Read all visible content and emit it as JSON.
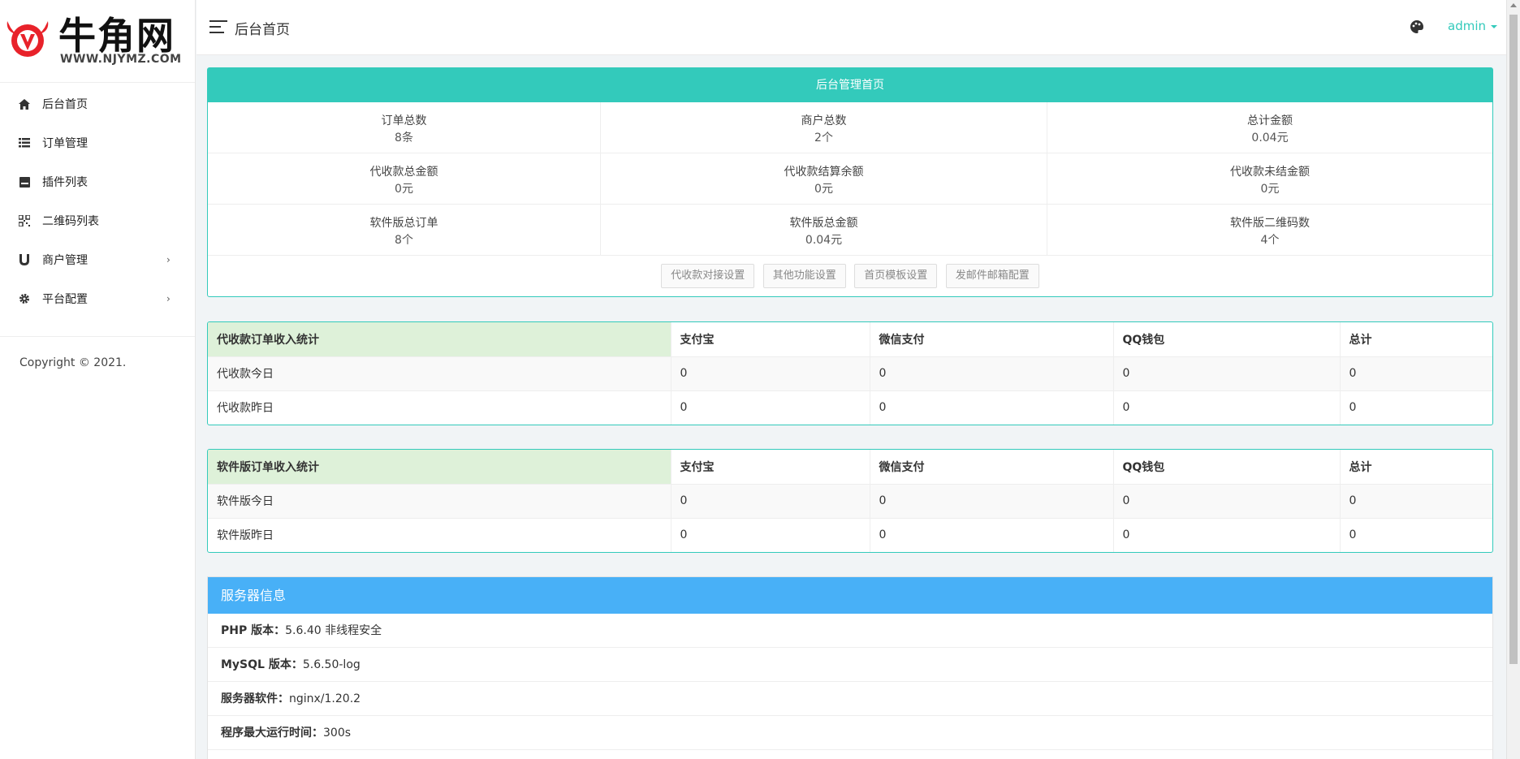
{
  "brand": {
    "name": "牛角网",
    "sub": "WWW.NJYMZ.COM",
    "color": "#e8222a"
  },
  "sidebar": {
    "items": [
      {
        "label": "后台首页",
        "icon": "home-icon"
      },
      {
        "label": "订单管理",
        "icon": "list-icon"
      },
      {
        "label": "插件列表",
        "icon": "plugin-icon"
      },
      {
        "label": "二维码列表",
        "icon": "qrcode-icon"
      },
      {
        "label": "商户管理",
        "icon": "magnet-icon",
        "arrow": "›"
      },
      {
        "label": "平台配置",
        "icon": "gear-icon",
        "arrow": "›"
      }
    ],
    "copyright": "Copyright © 2021."
  },
  "header": {
    "breadcrumb": "后台首页",
    "user": "admin",
    "accent": "#33cabb"
  },
  "overview": {
    "title": "后台管理首页",
    "stats": [
      {
        "label": "订单总数",
        "value": "8条"
      },
      {
        "label": "商户总数",
        "value": "2个"
      },
      {
        "label": "总计金额",
        "value": "0.04元"
      },
      {
        "label": "代收款总金额",
        "value": "0元"
      },
      {
        "label": "代收款结算余额",
        "value": "0元"
      },
      {
        "label": "代收款未结金额",
        "value": "0元"
      },
      {
        "label": "软件版总订单",
        "value": "8个"
      },
      {
        "label": "软件版总金额",
        "value": "0.04元"
      },
      {
        "label": "软件版二维码数",
        "value": "4个"
      }
    ],
    "buttons": [
      "代收款对接设置",
      "其他功能设置",
      "首页模板设置",
      "发邮件邮箱配置"
    ]
  },
  "collect_table": {
    "headers": [
      "代收款订单收入统计",
      "支付宝",
      "微信支付",
      "QQ钱包",
      "总计"
    ],
    "rows": [
      [
        "代收款今日",
        "0",
        "0",
        "0",
        "0"
      ],
      [
        "代收款昨日",
        "0",
        "0",
        "0",
        "0"
      ]
    ]
  },
  "software_table": {
    "headers": [
      "软件版订单收入统计",
      "支付宝",
      "微信支付",
      "QQ钱包",
      "总计"
    ],
    "rows": [
      [
        "软件版今日",
        "0",
        "0",
        "0",
        "0"
      ],
      [
        "软件版昨日",
        "0",
        "0",
        "0",
        "0"
      ]
    ]
  },
  "server": {
    "title": "服务器信息",
    "rows": [
      {
        "label": "PHP 版本：",
        "value": "5.6.40 非线程安全"
      },
      {
        "label": "MySQL 版本：",
        "value": "5.6.50-log"
      },
      {
        "label": "服务器软件：",
        "value": "nginx/1.20.2"
      },
      {
        "label": "程序最大运行时间：",
        "value": "300s"
      }
    ]
  }
}
